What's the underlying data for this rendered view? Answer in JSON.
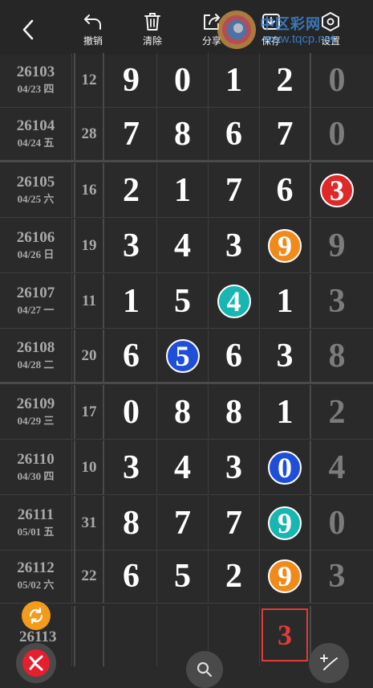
{
  "toolbar": {
    "back_icon": "chevron-left-icon",
    "tools": [
      {
        "label": "撤销",
        "icon": "undo-icon"
      },
      {
        "label": "清除",
        "icon": "trash-icon"
      },
      {
        "label": "分享",
        "icon": "share-icon"
      },
      {
        "label": "保存",
        "icon": "download-icon"
      },
      {
        "label": "设置",
        "icon": "settings-icon"
      }
    ]
  },
  "watermark": {
    "text": "中区彩网",
    "url": "www.tqcp.net"
  },
  "rows": [
    {
      "period": "26103",
      "date": "04/23 四",
      "sum": "12",
      "digits": [
        "9",
        "0",
        "1",
        "2"
      ],
      "tail": "0",
      "highlight": null
    },
    {
      "period": "26104",
      "date": "04/24 五",
      "sum": "28",
      "digits": [
        "7",
        "8",
        "6",
        "7"
      ],
      "tail": "0",
      "highlight": null
    },
    {
      "period": "26105",
      "date": "04/25 六",
      "sum": "16",
      "digits": [
        "2",
        "1",
        "7",
        "6"
      ],
      "tail": "3",
      "highlight": {
        "col": 4,
        "color": "red"
      }
    },
    {
      "period": "26106",
      "date": "04/26 日",
      "sum": "19",
      "digits": [
        "3",
        "4",
        "3",
        "9"
      ],
      "tail": "9",
      "highlight": {
        "col": 3,
        "color": "orange"
      }
    },
    {
      "period": "26107",
      "date": "04/27 一",
      "sum": "11",
      "digits": [
        "1",
        "5",
        "4",
        "1"
      ],
      "tail": "3",
      "highlight": {
        "col": 2,
        "color": "teal"
      }
    },
    {
      "period": "26108",
      "date": "04/28 二",
      "sum": "20",
      "digits": [
        "6",
        "5",
        "6",
        "3"
      ],
      "tail": "8",
      "highlight": {
        "col": 1,
        "color": "blue"
      }
    },
    {
      "period": "26109",
      "date": "04/29 三",
      "sum": "17",
      "digits": [
        "0",
        "8",
        "8",
        "1"
      ],
      "tail": "2",
      "highlight": null
    },
    {
      "period": "26110",
      "date": "04/30 四",
      "sum": "10",
      "digits": [
        "3",
        "4",
        "3",
        "0"
      ],
      "tail": "4",
      "highlight": {
        "col": 3,
        "color": "blue"
      }
    },
    {
      "period": "26111",
      "date": "05/01 五",
      "sum": "31",
      "digits": [
        "8",
        "7",
        "7",
        "9"
      ],
      "tail": "0",
      "highlight": {
        "col": 3,
        "color": "teal"
      }
    },
    {
      "period": "26112",
      "date": "05/02 六",
      "sum": "22",
      "digits": [
        "6",
        "5",
        "2",
        "9"
      ],
      "tail": "3",
      "highlight": {
        "col": 3,
        "color": "orange"
      }
    }
  ],
  "next_period": "26113",
  "prediction": "3",
  "fabs": {
    "refresh_icon": "refresh-icon",
    "brand_icon": "brand-logo-icon",
    "search_icon": "search-icon",
    "pen_icon": "pen-add-icon"
  }
}
